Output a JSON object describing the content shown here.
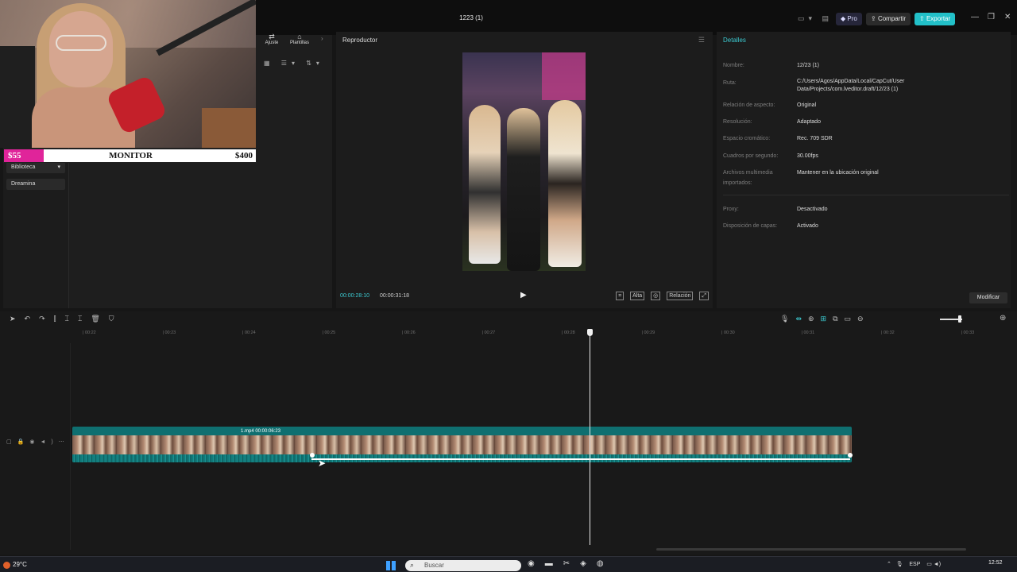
{
  "window": {
    "title": "1223 (1)",
    "pro_label": "Pro",
    "share_label": "Compartir",
    "export_label": "Exportar",
    "minimize": "—",
    "restore": "❐",
    "close": "✕"
  },
  "overlay": {
    "donation_left": "$55",
    "monitor_label": "MONITOR",
    "donation_right": "$400"
  },
  "left_panel": {
    "tabs": [
      {
        "icon": "⇄",
        "label": "Ajuste"
      },
      {
        "icon": "⌂",
        "label": "Plantillas"
      }
    ],
    "sidebar": [
      "Biblioteca",
      "Dreamina"
    ]
  },
  "player": {
    "title": "Reproductor",
    "time_current": "00:00:28:10",
    "time_total": "00:00:31:18",
    "tools": [
      "Alta",
      "Relación"
    ]
  },
  "details": {
    "title": "Detalles",
    "rows": [
      {
        "label": "Nombre:",
        "value": "12/23 (1)"
      },
      {
        "label": "Ruta:",
        "value": "C:/Users/Agos/AppData/Local/CapCut/User Data/Projects/com.lveditor.draft/12/23 (1)"
      },
      {
        "label": "Relación de aspecto:",
        "value": "Original"
      },
      {
        "label": "Resolución:",
        "value": "Adaptado"
      },
      {
        "label": "Espacio cromático:",
        "value": "Rec. 709 SDR"
      },
      {
        "label": "Cuadros por segundo:",
        "value": "30.00fps"
      },
      {
        "label": "Archivos multimedia importados:",
        "value": "Mantener en la ubicación original"
      },
      {
        "label": "Proxy:",
        "value": "Desactivado"
      },
      {
        "label": "Disposición de capas:",
        "value": "Activado"
      }
    ],
    "modify_label": "Modificar"
  },
  "timeline": {
    "ruler_ticks": [
      "00:22",
      "00:23",
      "00:24",
      "00:25",
      "00:26",
      "00:27",
      "00:28",
      "00:29",
      "00:30",
      "00:31",
      "00:32",
      "00:33"
    ],
    "clip_label": "1.mp4  00:00:06:23"
  },
  "taskbar": {
    "weather": "29°C",
    "search_placeholder": "Buscar",
    "language": "ESP",
    "time": "12:52"
  }
}
